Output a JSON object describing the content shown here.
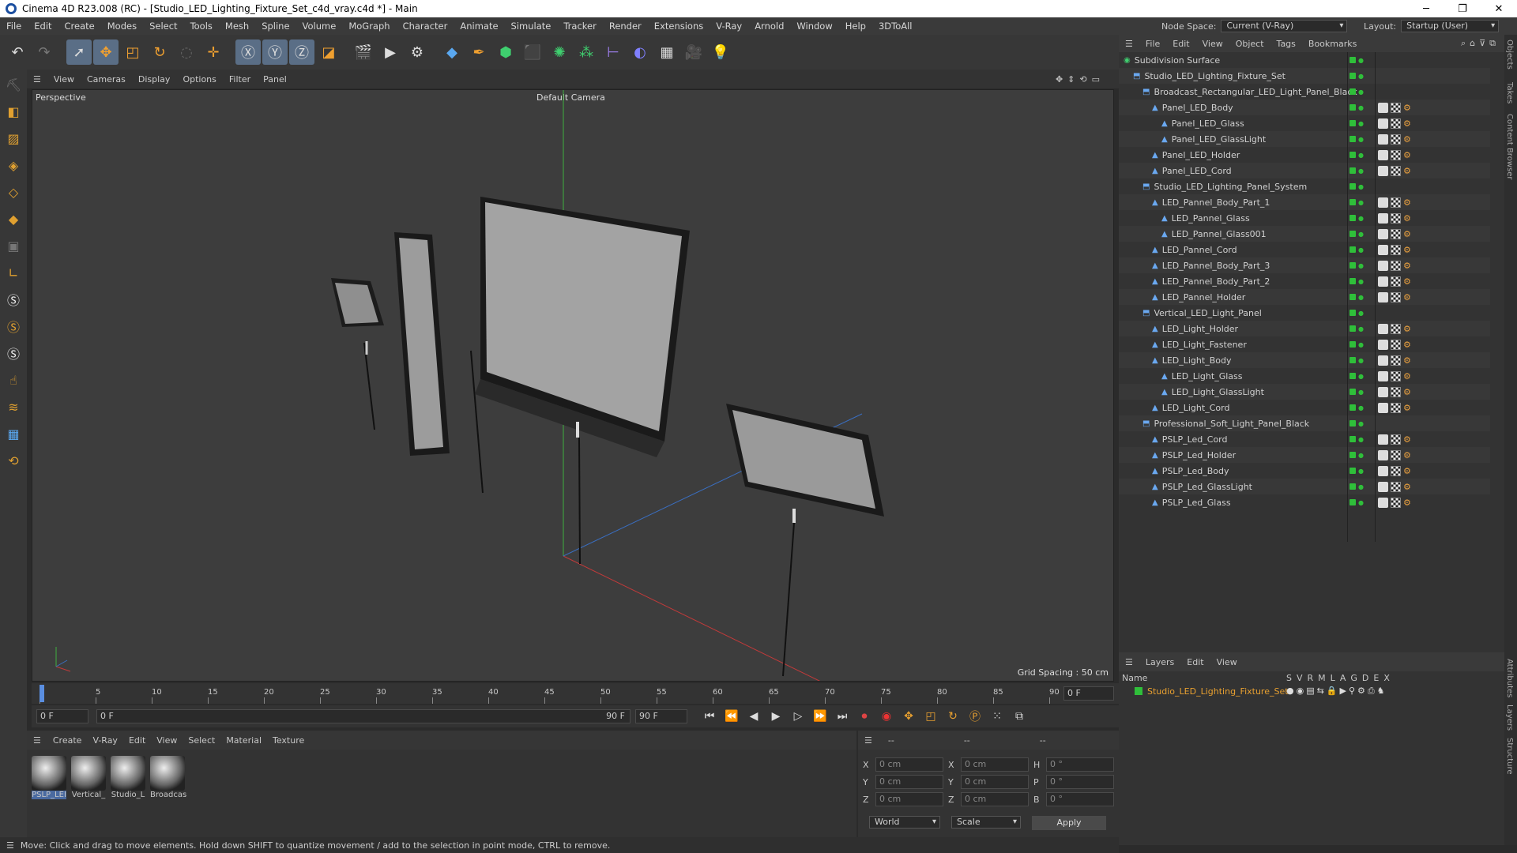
{
  "title": {
    "text": "Cinema 4D R23.008 (RC) - [Studio_LED_Lighting_Fixture_Set_c4d_vray.c4d *] - Main",
    "min": "─",
    "max": "❐",
    "close": "✕"
  },
  "menu": [
    "File",
    "Edit",
    "Create",
    "Modes",
    "Select",
    "Tools",
    "Mesh",
    "Spline",
    "Volume",
    "MoGraph",
    "Character",
    "Animate",
    "Simulate",
    "Tracker",
    "Render",
    "Extensions",
    "V-Ray",
    "Arnold",
    "Window",
    "Help",
    "3DToAll"
  ],
  "nodespace": {
    "label": "Node Space:",
    "value": "Current (V-Ray)"
  },
  "layout": {
    "label": "Layout:",
    "value": "Startup (User)"
  },
  "viewport": {
    "menu": [
      "View",
      "Cameras",
      "Display",
      "Options",
      "Filter",
      "Panel"
    ],
    "name": "Perspective",
    "camera": "Default Camera",
    "grid": "Grid Spacing : 50 cm"
  },
  "timeline": {
    "ticks": [
      "0",
      "5",
      "10",
      "15",
      "20",
      "25",
      "30",
      "35",
      "40",
      "45",
      "50",
      "55",
      "60",
      "65",
      "70",
      "75",
      "80",
      "85",
      "90"
    ],
    "frame_right": "0 F"
  },
  "transport": {
    "start": "0 F",
    "cur": "0 F",
    "end_slider": "90 F",
    "end": "90 F"
  },
  "materials": {
    "menu": [
      "Create",
      "V-Ray",
      "Edit",
      "View",
      "Select",
      "Material",
      "Texture"
    ],
    "items": [
      "PSLP_LEI",
      "Vertical_",
      "Studio_L",
      "Broadcas"
    ]
  },
  "coords": {
    "headers": [
      "--",
      "--",
      "--"
    ],
    "rows": [
      {
        "a": "X",
        "av": "0 cm",
        "b": "X",
        "bv": "0 cm",
        "c": "H",
        "cv": "0 °"
      },
      {
        "a": "Y",
        "av": "0 cm",
        "b": "Y",
        "bv": "0 cm",
        "c": "P",
        "cv": "0 °"
      },
      {
        "a": "Z",
        "av": "0 cm",
        "b": "Z",
        "bv": "0 cm",
        "c": "B",
        "cv": "0 °"
      }
    ],
    "world": "World",
    "scale": "Scale",
    "apply": "Apply"
  },
  "objects": {
    "menu": [
      "File",
      "Edit",
      "View",
      "Object",
      "Tags",
      "Bookmarks"
    ],
    "rows": [
      {
        "name": "Subdivision Surface",
        "indent": 0,
        "tags": false
      },
      {
        "name": "Studio_LED_Lighting_Fixture_Set",
        "indent": 1,
        "tags": false
      },
      {
        "name": "Broadcast_Rectangular_LED_Light_Panel_Black",
        "indent": 2,
        "tags": false
      },
      {
        "name": "Panel_LED_Body",
        "indent": 3,
        "tags": true
      },
      {
        "name": "Panel_LED_Glass",
        "indent": 4,
        "tags": true
      },
      {
        "name": "Panel_LED_GlassLight",
        "indent": 4,
        "tags": true
      },
      {
        "name": "Panel_LED_Holder",
        "indent": 3,
        "tags": true
      },
      {
        "name": "Panel_LED_Cord",
        "indent": 3,
        "tags": true
      },
      {
        "name": "Studio_LED_Lighting_Panel_System",
        "indent": 2,
        "tags": false
      },
      {
        "name": "LED_Pannel_Body_Part_1",
        "indent": 3,
        "tags": true
      },
      {
        "name": "LED_Pannel_Glass",
        "indent": 4,
        "tags": true
      },
      {
        "name": "LED_Pannel_Glass001",
        "indent": 4,
        "tags": true
      },
      {
        "name": "LED_Pannel_Cord",
        "indent": 3,
        "tags": true
      },
      {
        "name": "LED_Pannel_Body_Part_3",
        "indent": 3,
        "tags": true
      },
      {
        "name": "LED_Pannel_Body_Part_2",
        "indent": 3,
        "tags": true
      },
      {
        "name": "LED_Pannel_Holder",
        "indent": 3,
        "tags": true
      },
      {
        "name": "Vertical_LED_Light_Panel",
        "indent": 2,
        "tags": false
      },
      {
        "name": "LED_Light_Holder",
        "indent": 3,
        "tags": true
      },
      {
        "name": "LED_Light_Fastener",
        "indent": 3,
        "tags": true
      },
      {
        "name": "LED_Light_Body",
        "indent": 3,
        "tags": true
      },
      {
        "name": "LED_Light_Glass",
        "indent": 4,
        "tags": true
      },
      {
        "name": "LED_Light_GlassLight",
        "indent": 4,
        "tags": true
      },
      {
        "name": "LED_Light_Cord",
        "indent": 3,
        "tags": true
      },
      {
        "name": "Professional_Soft_Light_Panel_Black",
        "indent": 2,
        "tags": false
      },
      {
        "name": "PSLP_Led_Cord",
        "indent": 3,
        "tags": true
      },
      {
        "name": "PSLP_Led_Holder",
        "indent": 3,
        "tags": true
      },
      {
        "name": "PSLP_Led_Body",
        "indent": 3,
        "tags": true
      },
      {
        "name": "PSLP_Led_GlassLight",
        "indent": 3,
        "tags": true
      },
      {
        "name": "PSLP_Led_Glass",
        "indent": 3,
        "tags": true
      }
    ]
  },
  "layers": {
    "menu": [
      "Layers",
      "Edit",
      "View"
    ],
    "header": "Name",
    "flags": [
      "S",
      "V",
      "R",
      "M",
      "L",
      "A",
      "G",
      "D",
      "E",
      "X"
    ],
    "row": "Studio_LED_Lighting_Fixture_Set"
  },
  "sidetabs": [
    "Objects",
    "Takes",
    "Content Browser",
    "Attributes",
    "Layers",
    "Structure"
  ],
  "status": "Move: Click and drag to move elements. Hold down SHIFT to quantize movement / add to the selection in point mode, CTRL to remove.",
  "colors": {
    "accent": "#5a6e86",
    "green": "#2fbf3a",
    "layer": "#e8a030"
  }
}
